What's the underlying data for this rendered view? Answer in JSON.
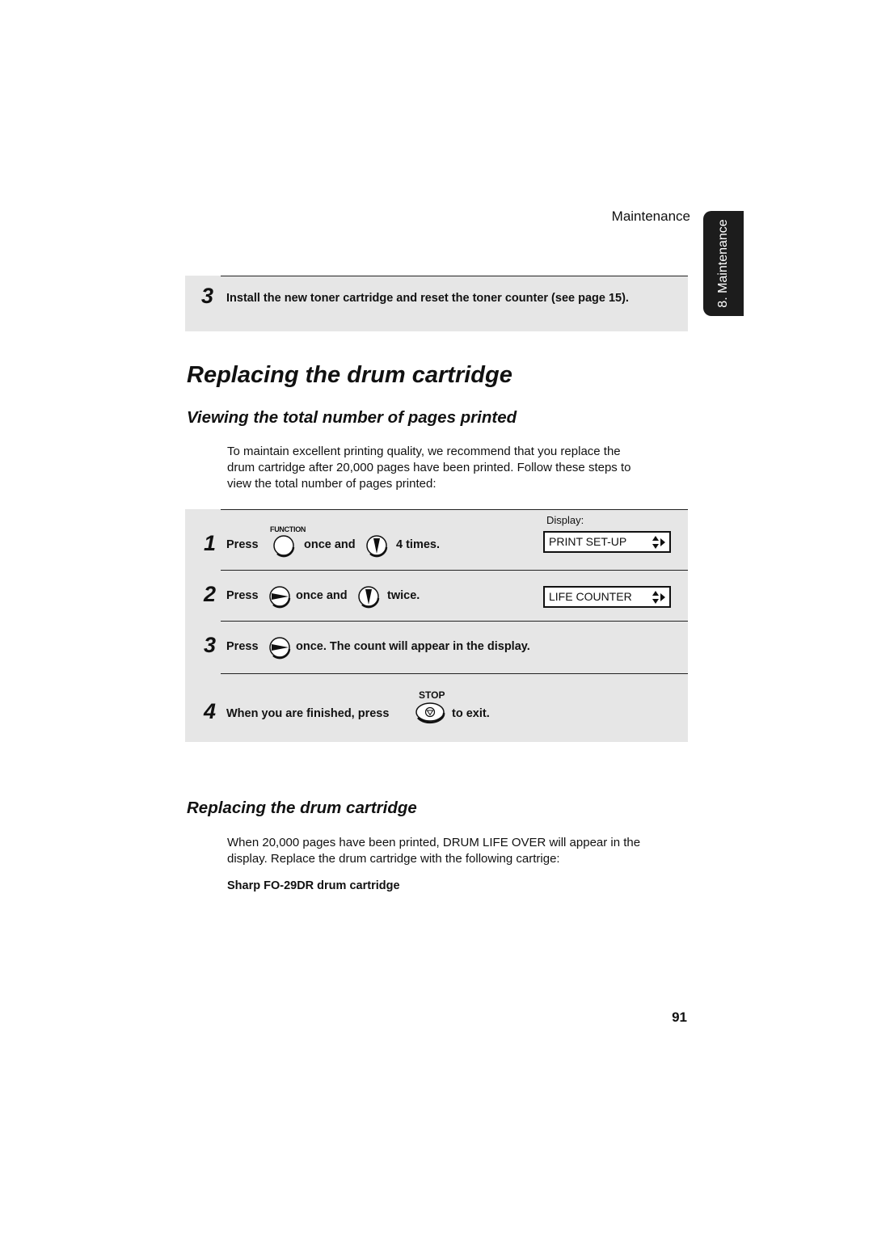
{
  "header": {
    "running_title": "Maintenance",
    "side_tab": "8. Maintenance"
  },
  "top_step": {
    "number": "3",
    "text": "Install the new toner cartridge and reset the toner counter (see page 15)."
  },
  "section": {
    "title": "Replacing the drum cartridge",
    "subsection_1": {
      "title": "Viewing the total number of pages printed",
      "intro_lines": [
        "To maintain excellent printing quality, we recommend that you replace the",
        "drum cartridge after 20,000 pages have been printed. Follow these steps to",
        "view the total number of pages printed:"
      ],
      "display_caption": "Display:",
      "steps": [
        {
          "number": "1",
          "parts": [
            "Press",
            "once and",
            "4 times."
          ],
          "button_label": "FUNCTION",
          "icons": [
            "function-button-icon",
            "down-arrow-button-icon"
          ],
          "display": "PRINT SET-UP"
        },
        {
          "number": "2",
          "parts": [
            "Press",
            "once and",
            "twice."
          ],
          "icons": [
            "right-arrow-button-icon",
            "down-arrow-button-icon"
          ],
          "display": "LIFE COUNTER"
        },
        {
          "number": "3",
          "parts": [
            "Press",
            "once. The count will appear in the display."
          ],
          "icons": [
            "right-arrow-button-icon"
          ]
        },
        {
          "number": "4",
          "parts": [
            "When you are finished, press",
            "to exit."
          ],
          "button_label": "STOP",
          "icons": [
            "stop-button-icon"
          ]
        }
      ]
    },
    "subsection_2": {
      "title": "Replacing the drum cartridge",
      "body_lines": [
        "When 20,000 pages have been printed, DRUM LIFE OVER will appear in the",
        "display. Replace the drum cartridge with the following cartrige:"
      ],
      "cartridge": "Sharp FO-29DR drum cartridge"
    }
  },
  "footer": {
    "page_number": "91"
  },
  "colors": {
    "step_box_bg": "#e6e6e6",
    "side_tab_bg": "#1c1c1c",
    "text": "#111111"
  }
}
